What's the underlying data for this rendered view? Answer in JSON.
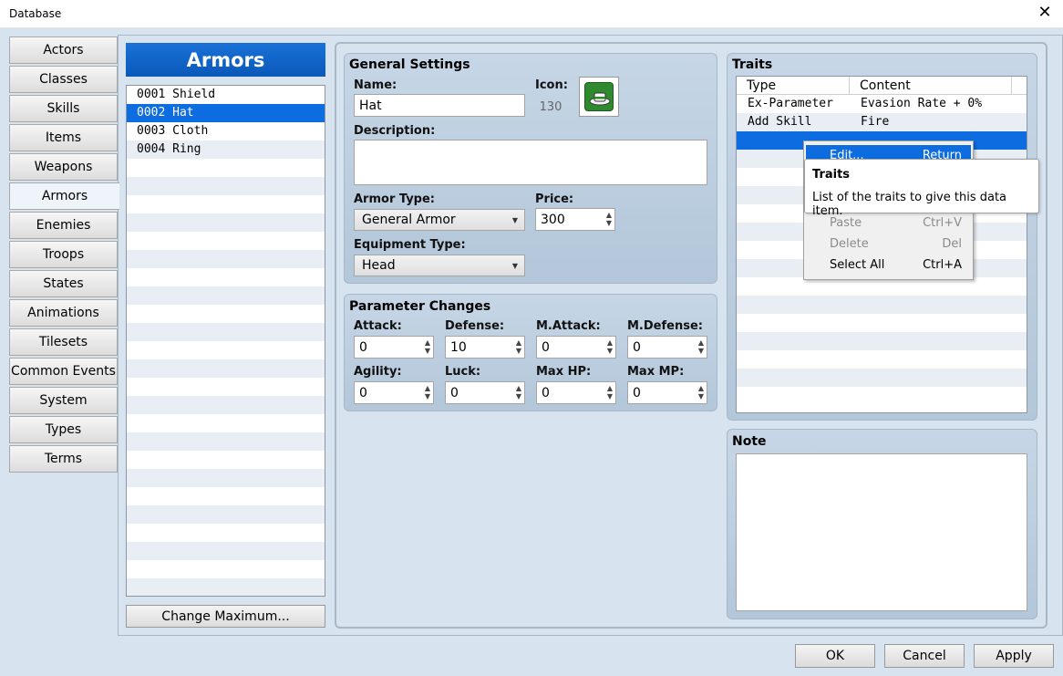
{
  "window": {
    "title": "Database",
    "close_glyph": "✕"
  },
  "tabs": [
    "Actors",
    "Classes",
    "Skills",
    "Items",
    "Weapons",
    "Armors",
    "Enemies",
    "Troops",
    "States",
    "Animations",
    "Tilesets",
    "Common Events",
    "System",
    "Types",
    "Terms"
  ],
  "active_tab": "Armors",
  "list": {
    "header": "Armors",
    "items": [
      "0001 Shield",
      "0002 Hat",
      "0003 Cloth",
      "0004 Ring"
    ],
    "selected_index": 1,
    "change_max_label": "Change Maximum..."
  },
  "general": {
    "title": "General Settings",
    "name_label": "Name:",
    "name_value": "Hat",
    "icon_label": "Icon:",
    "icon_index": "130",
    "icon_name": "hat-icon",
    "description_label": "Description:",
    "description_value": "",
    "armor_type_label": "Armor Type:",
    "armor_type_value": "General Armor",
    "price_label": "Price:",
    "price_value": "300",
    "equip_type_label": "Equipment Type:",
    "equip_type_value": "Head"
  },
  "params": {
    "title": "Parameter Changes",
    "fields": [
      {
        "label": "Attack:",
        "value": "0"
      },
      {
        "label": "Defense:",
        "value": "10"
      },
      {
        "label": "M.Attack:",
        "value": "0"
      },
      {
        "label": "M.Defense:",
        "value": "0"
      },
      {
        "label": "Agility:",
        "value": "0"
      },
      {
        "label": "Luck:",
        "value": "0"
      },
      {
        "label": "Max HP:",
        "value": "0"
      },
      {
        "label": "Max MP:",
        "value": "0"
      }
    ]
  },
  "traits": {
    "title": "Traits",
    "col_type": "Type",
    "col_content": "Content",
    "rows": [
      {
        "type": "Ex-Parameter",
        "content": "Evasion Rate + 0%"
      },
      {
        "type": "Add Skill",
        "content": "Fire"
      }
    ]
  },
  "note": {
    "title": "Note",
    "value": ""
  },
  "context_menu": [
    {
      "label": "Edit...",
      "shortcut": "Return",
      "state": "highlighted"
    },
    {
      "label": "Paste",
      "shortcut": "Ctrl+V",
      "state": "disabled"
    },
    {
      "label": "Delete",
      "shortcut": "Del",
      "state": "disabled"
    },
    {
      "label": "Select All",
      "shortcut": "Ctrl+A",
      "state": "enabled"
    }
  ],
  "tooltip": {
    "title": "Traits",
    "body": "List of the traits to give this data item."
  },
  "buttons": {
    "ok": "OK",
    "cancel": "Cancel",
    "apply": "Apply"
  },
  "colors": {
    "accent": "#0c6ce0",
    "panel": "#d7e3ee",
    "group": "#bfd1e3"
  }
}
